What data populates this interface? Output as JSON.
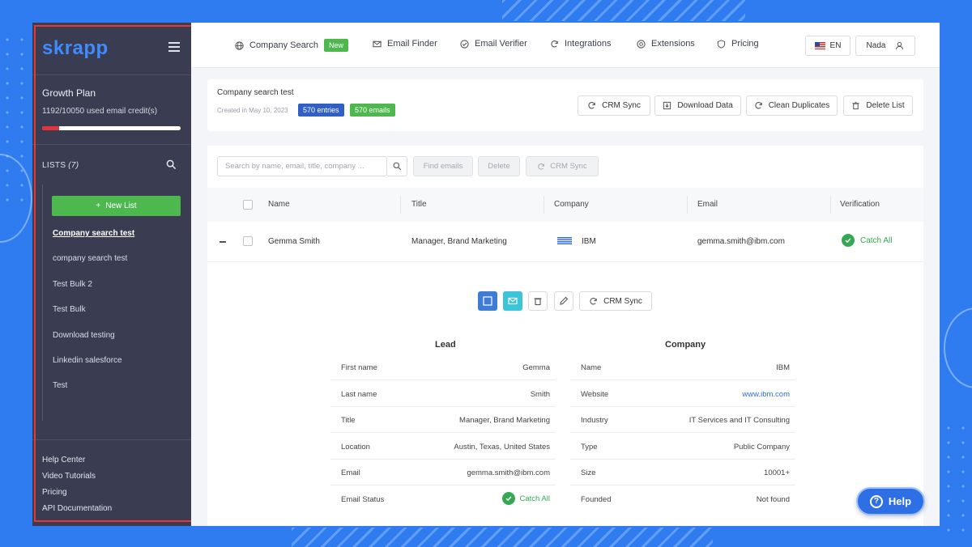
{
  "sidebar": {
    "logo": "skrapp",
    "plan_title": "Growth Plan",
    "credits_text": "1192/10050 used email credit(s)",
    "credits_used_fraction": 0.12,
    "lists_label": "LISTS",
    "lists_count": "(7)",
    "new_list_label": "New List",
    "lists": [
      "Company search test",
      "company search test",
      "Test Bulk 2",
      "Test Bulk",
      "Download testing",
      "Linkedin salesforce",
      "Test"
    ],
    "footer_links": [
      "Help Center",
      "Video Tutorials",
      "Pricing",
      "API Documentation"
    ]
  },
  "topnav": {
    "items": [
      "Company Search",
      "Email Finder",
      "Email Verifier",
      "Integrations",
      "Extensions",
      "Pricing"
    ],
    "new_badge": "New",
    "language": "EN",
    "user": "Nada"
  },
  "list_header": {
    "title": "Company search test",
    "created": "Created in May 10, 2023",
    "entries_badge": "570 entries",
    "emails_badge": "570 emails",
    "actions": [
      "CRM Sync",
      "Download Data",
      "Clean Duplicates",
      "Delete List"
    ]
  },
  "table": {
    "search_placeholder": "Search by name, email, title, company ...",
    "toolbar": [
      "Find emails",
      "Delete",
      "CRM Sync"
    ],
    "columns": [
      "Name",
      "Title",
      "Company",
      "Email",
      "Verification"
    ],
    "row": {
      "name": "Gemma Smith",
      "title": "Manager, Brand Marketing",
      "company": "IBM",
      "email": "gemma.smith@ibm.com",
      "verification": "Catch All"
    }
  },
  "detail": {
    "crm_sync_label": "CRM Sync",
    "lead_title": "Lead",
    "company_title": "Company",
    "lead": [
      {
        "k": "First name",
        "v": "Gemma"
      },
      {
        "k": "Last name",
        "v": "Smith"
      },
      {
        "k": "Title",
        "v": "Manager, Brand Marketing"
      },
      {
        "k": "Location",
        "v": "Austin, Texas, United States"
      },
      {
        "k": "Email",
        "v": "gemma.smith@ibm.com"
      },
      {
        "k": "Email Status",
        "v": "Catch All"
      }
    ],
    "company": [
      {
        "k": "Name",
        "v": "IBM"
      },
      {
        "k": "Website",
        "v": "www.ibm.com"
      },
      {
        "k": "Industry",
        "v": "IT Services and IT Consulting"
      },
      {
        "k": "Type",
        "v": "Public Company"
      },
      {
        "k": "Size",
        "v": "10001+"
      },
      {
        "k": "Founded",
        "v": "Not found"
      }
    ]
  },
  "help_label": "Help",
  "colors": {
    "brand_blue": "#3f8cff",
    "green": "#4db84e",
    "sidebar_bg": "#3a3c52",
    "highlight_red": "#e23a3a"
  }
}
